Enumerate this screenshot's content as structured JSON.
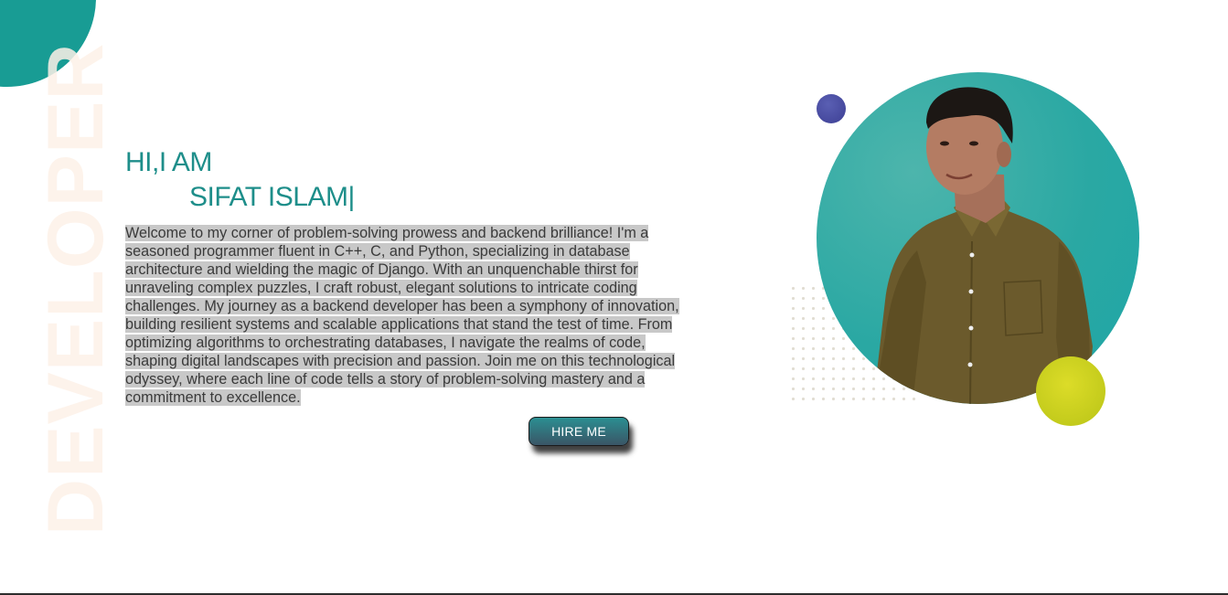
{
  "hero": {
    "background_word": "DEVELOPER",
    "greeting": "HI,I AM",
    "name": "SIFAT ISLAM",
    "cursor": "|",
    "bio": "Welcome to my corner of problem-solving prowess and backend brilliance! I'm a seasoned programmer fluent in C++, C, and Python, specializing in database architecture and wielding the magic of Django. With an unquenchable thirst for unraveling complex puzzles, I craft robust, elegant solutions to intricate coding challenges. My journey as a backend developer has been a symphony of innovation, building resilient systems and scalable applications that stand the test of time. From optimizing algorithms to orchestrating databases, I navigate the realms of code, shaping digital landscapes with precision and passion. Join me on this technological odyssey, where each line of code tells a story of problem-solving mastery and a commitment to excellence.",
    "hire_button": "HIRE ME"
  },
  "colors": {
    "accent": "#1e8e8a",
    "corner_blob": "#189c94",
    "photo_bg": "#2aa8a3",
    "purple_dot": "#3d3f94",
    "yellow_dot": "#c8cf1e",
    "selection_highlight": "#c8c8c8"
  },
  "icons": {
    "profile_photo": "person-portrait-icon"
  }
}
